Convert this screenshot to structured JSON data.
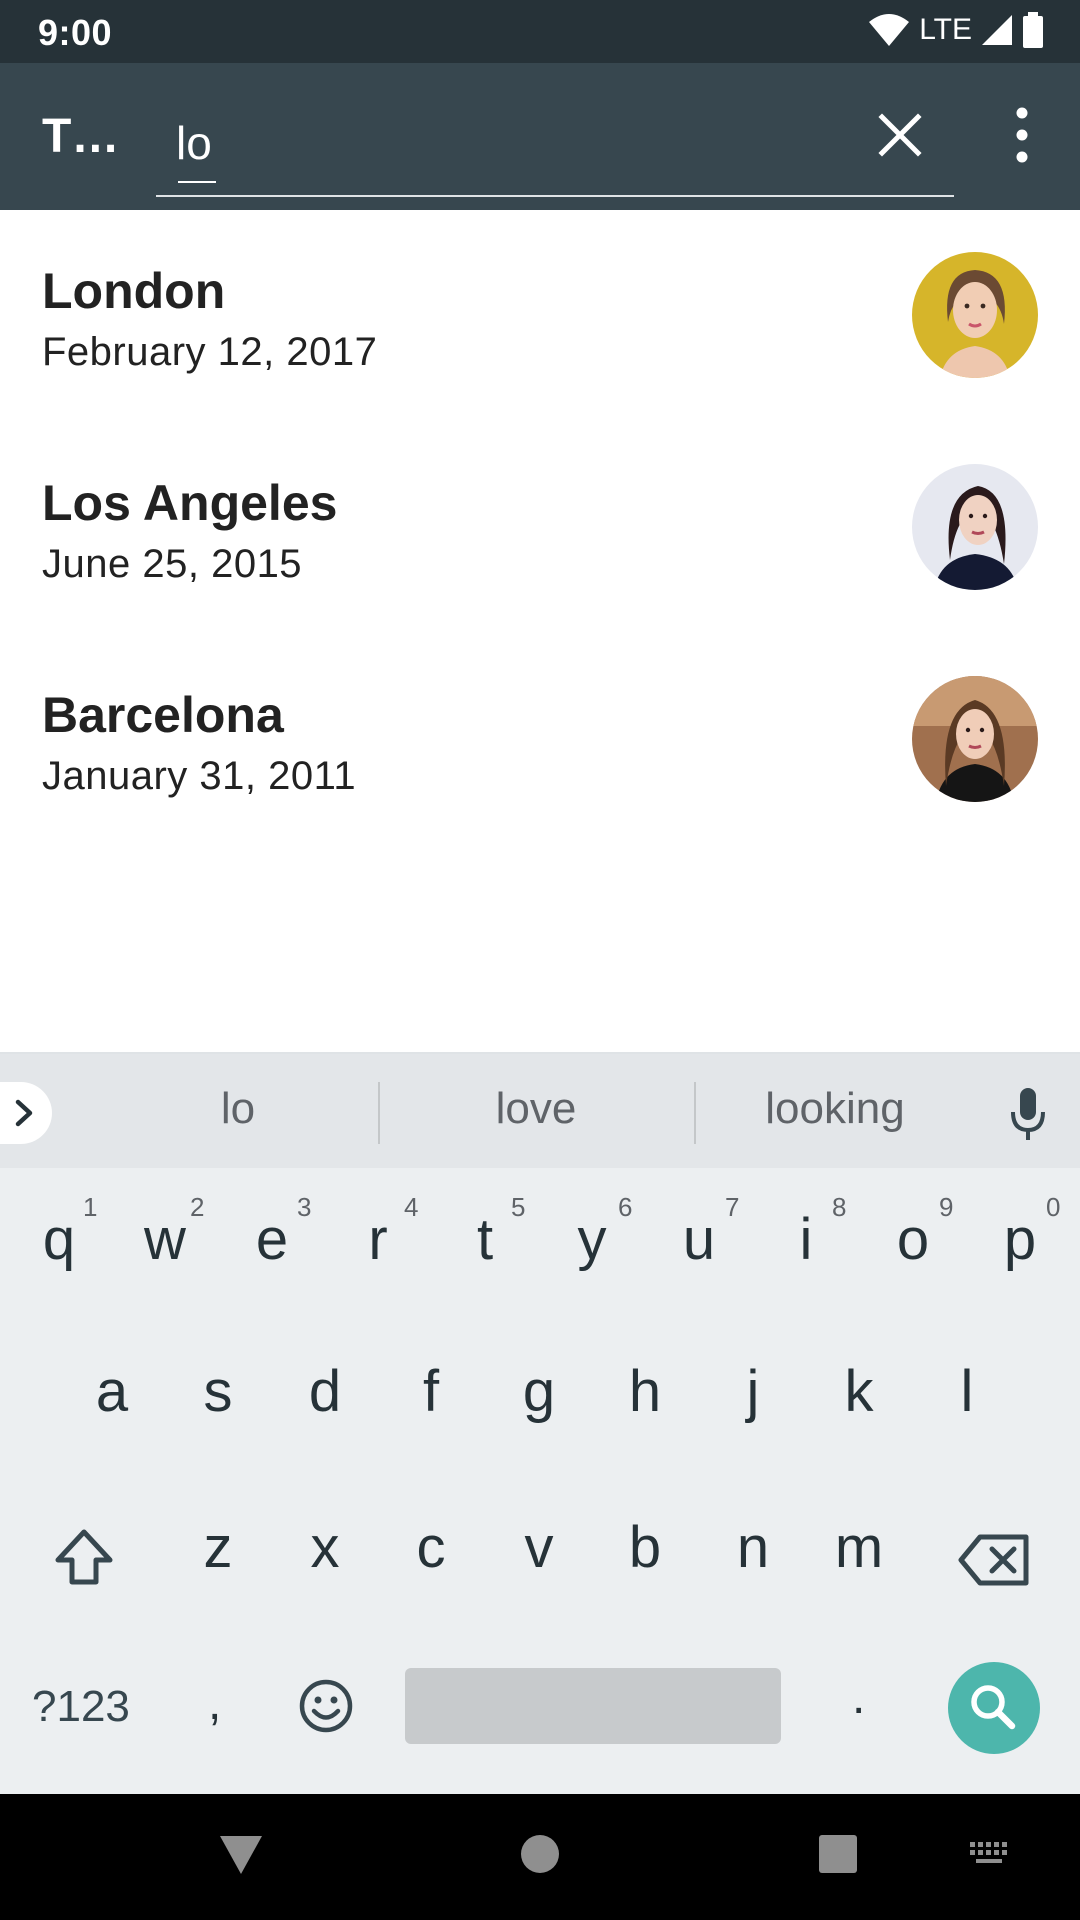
{
  "status_bar": {
    "time": "9:00",
    "network": "LTE"
  },
  "app_bar": {
    "title": "T…",
    "search_value": "lo",
    "search_placeholder": ""
  },
  "results": [
    {
      "title": "London",
      "date": "February 12, 2017",
      "avatar_color": "#d6b52a"
    },
    {
      "title": "Los Angeles",
      "date": "June 25, 2015",
      "avatar_color": "#e6e8f0"
    },
    {
      "title": "Barcelona",
      "date": "January 31, 2011",
      "avatar_color": "#9a6a4a"
    }
  ],
  "keyboard": {
    "suggestions": [
      "lo",
      "love",
      "looking"
    ],
    "row1": [
      {
        "key": "q",
        "num": "1"
      },
      {
        "key": "w",
        "num": "2"
      },
      {
        "key": "e",
        "num": "3"
      },
      {
        "key": "r",
        "num": "4"
      },
      {
        "key": "t",
        "num": "5"
      },
      {
        "key": "y",
        "num": "6"
      },
      {
        "key": "u",
        "num": "7"
      },
      {
        "key": "i",
        "num": "8"
      },
      {
        "key": "o",
        "num": "9"
      },
      {
        "key": "p",
        "num": "0"
      }
    ],
    "row2": [
      "a",
      "s",
      "d",
      "f",
      "g",
      "h",
      "j",
      "k",
      "l"
    ],
    "row3": [
      "z",
      "x",
      "c",
      "v",
      "b",
      "n",
      "m"
    ],
    "symbols_label": "?123",
    "comma": ",",
    "period": "."
  },
  "colors": {
    "status_bar": "#263238",
    "app_bar": "#37474f",
    "accent": "#4db6ac",
    "keyboard_bg": "#eceff1"
  },
  "icons": {
    "status": [
      "wifi-icon",
      "signal-icon",
      "battery-icon"
    ],
    "app_bar": [
      "close-icon",
      "more-vert-icon"
    ],
    "keyboard": [
      "chevron-right-icon",
      "mic-icon",
      "shift-icon",
      "backspace-icon",
      "emoji-icon",
      "search-icon"
    ],
    "nav": [
      "back-icon",
      "home-icon",
      "recents-icon",
      "keyboard-switch-icon"
    ]
  }
}
